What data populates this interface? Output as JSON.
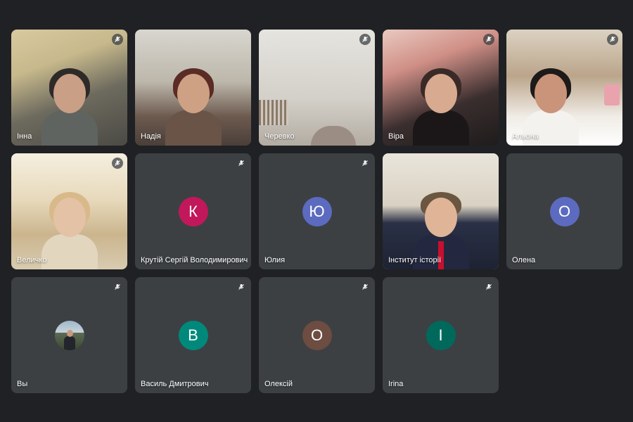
{
  "participants": [
    {
      "name": "Інна",
      "type": "video",
      "muted": true
    },
    {
      "name": "Надія",
      "type": "video",
      "muted": false
    },
    {
      "name": "Черевко",
      "type": "video",
      "muted": true
    },
    {
      "name": "Віра",
      "type": "video",
      "muted": true
    },
    {
      "name": "Альона",
      "type": "video",
      "muted": true
    },
    {
      "name": "Величко",
      "type": "video",
      "muted": true
    },
    {
      "name": "Крутій Сергій Володимирович",
      "type": "avatar",
      "initial": "К",
      "avatar_color": "#c2185b",
      "muted": true
    },
    {
      "name": "Юлия",
      "type": "avatar",
      "initial": "Ю",
      "avatar_color": "#5c6bc0",
      "muted": true
    },
    {
      "name": "Інститут історії",
      "type": "video",
      "muted": false,
      "active_speaker": true
    },
    {
      "name": "Олена",
      "type": "avatar",
      "initial": "О",
      "avatar_color": "#5c6bc0",
      "muted": false
    },
    {
      "name": "Вы",
      "type": "photo-avatar",
      "muted": true
    },
    {
      "name": "Василь Дмитрович",
      "type": "avatar",
      "initial": "В",
      "avatar_color": "#00897b",
      "muted": true
    },
    {
      "name": "Олексій",
      "type": "avatar",
      "initial": "О",
      "avatar_color": "#6d4c41",
      "muted": true
    },
    {
      "name": "Irina",
      "type": "avatar",
      "initial": "І",
      "avatar_color": "#00695c",
      "muted": true
    }
  ],
  "colors": {
    "background": "#202124",
    "tile": "#3c4043",
    "active_border": "#8ab4f8"
  },
  "icons": {
    "muted": "mic-off-icon"
  }
}
